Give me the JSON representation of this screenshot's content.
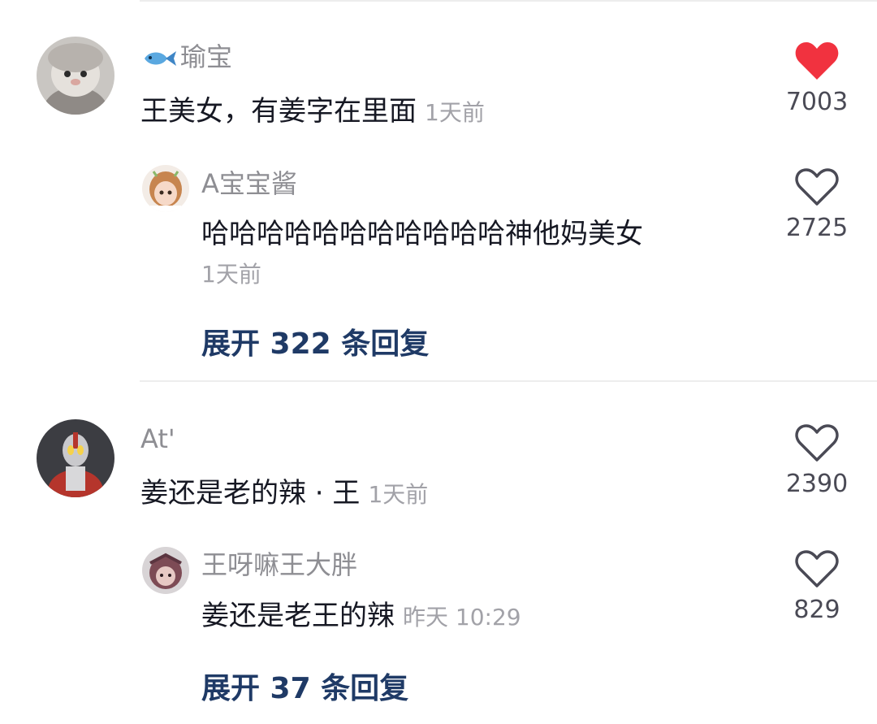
{
  "comments": [
    {
      "username": "瑜宝",
      "text": "王美女，有姜字在里面",
      "time": "1天前",
      "likes": "7003",
      "liked": true,
      "reply": {
        "username": "A宝宝酱",
        "text": "哈哈哈哈哈哈哈哈哈哈哈神他妈美女",
        "time": "1天前",
        "likes": "2725",
        "liked": false
      },
      "expand_label": "展开 322 条回复"
    },
    {
      "username": "At'",
      "text": "姜还是老的辣 · 王",
      "time": "1天前",
      "likes": "2390",
      "liked": false,
      "reply": {
        "username": "王呀嘛王大胖",
        "text": "姜还是老王的辣",
        "time": "昨天 10:29",
        "likes": "829",
        "liked": false
      },
      "expand_label": "展开 37 条回复"
    }
  ],
  "colors": {
    "like_active": "#f1323f",
    "link": "#1f3a66",
    "muted": "#8e8e93"
  },
  "icons": {
    "liked": "heart-filled-icon",
    "unliked": "heart-outline-icon",
    "username_prefix": "fish-icon"
  }
}
